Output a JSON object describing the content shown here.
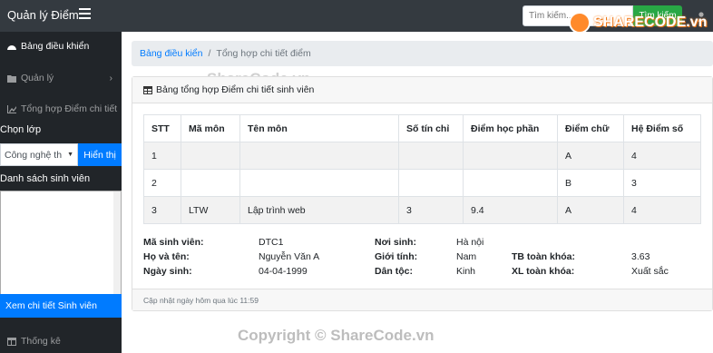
{
  "navbar": {
    "brand": "Quản lý Điểm",
    "search_placeholder": "Tìm kiếm...",
    "search_button": "Tìm kiếm"
  },
  "sidebar": {
    "items": [
      {
        "label": "Bảng điều khiển",
        "icon": "dashboard-icon"
      },
      {
        "label": "Quản lý",
        "icon": "folder-icon"
      },
      {
        "label": "Tổng hợp Điểm chi tiết",
        "icon": "chart-icon"
      }
    ],
    "choose_class_label": "Chọn lớp",
    "class_selected": "Công nghệ th",
    "show_button": "Hiển thị",
    "student_list_label": "Danh sách sinh viên",
    "detail_button": "Xem chi tiết Sinh viên",
    "stats_item": "Thống kê"
  },
  "breadcrumb": {
    "home": "Bảng điều kiển",
    "current": "Tổng hợp chi tiết điểm"
  },
  "card": {
    "title": "Bảng tổng hợp Điểm chi tiết sinh viên",
    "footer": "Cập nhật ngày hôm qua lúc 11:59"
  },
  "table": {
    "headers": [
      "STT",
      "Mã môn",
      "Tên môn",
      "Số tín chỉ",
      "Điểm học phần",
      "Điểm chữ",
      "Hệ Điểm số"
    ],
    "rows": [
      [
        "1",
        "",
        "",
        "",
        "",
        "A",
        "4"
      ],
      [
        "2",
        "",
        "",
        "",
        "",
        "B",
        "3"
      ],
      [
        "3",
        "LTW",
        "Lập trình web",
        "3",
        "9.4",
        "A",
        "4"
      ]
    ]
  },
  "student": {
    "id_label": "Mã sinh viên:",
    "id": "DTC1",
    "name_label": "Họ và tên:",
    "name": "Nguyễn Văn A",
    "dob_label": "Ngày sinh:",
    "dob": "04-04-1999",
    "hometown_label": "Nơi sinh:",
    "hometown": "Hà nội",
    "gender_label": "Giới tính:",
    "gender": "Nam",
    "ethnic_label": "Dân tộc:",
    "ethnic": "Kinh",
    "gpa_label": "TB toàn khóa:",
    "gpa": "3.63",
    "rank_label": "XL toàn khóa:",
    "rank": "Xuất sắc"
  },
  "watermark": {
    "logo": "SHARECODE.vn",
    "center": "ShareCode.vn",
    "bottom": "Copyright © ShareCode.vn"
  }
}
